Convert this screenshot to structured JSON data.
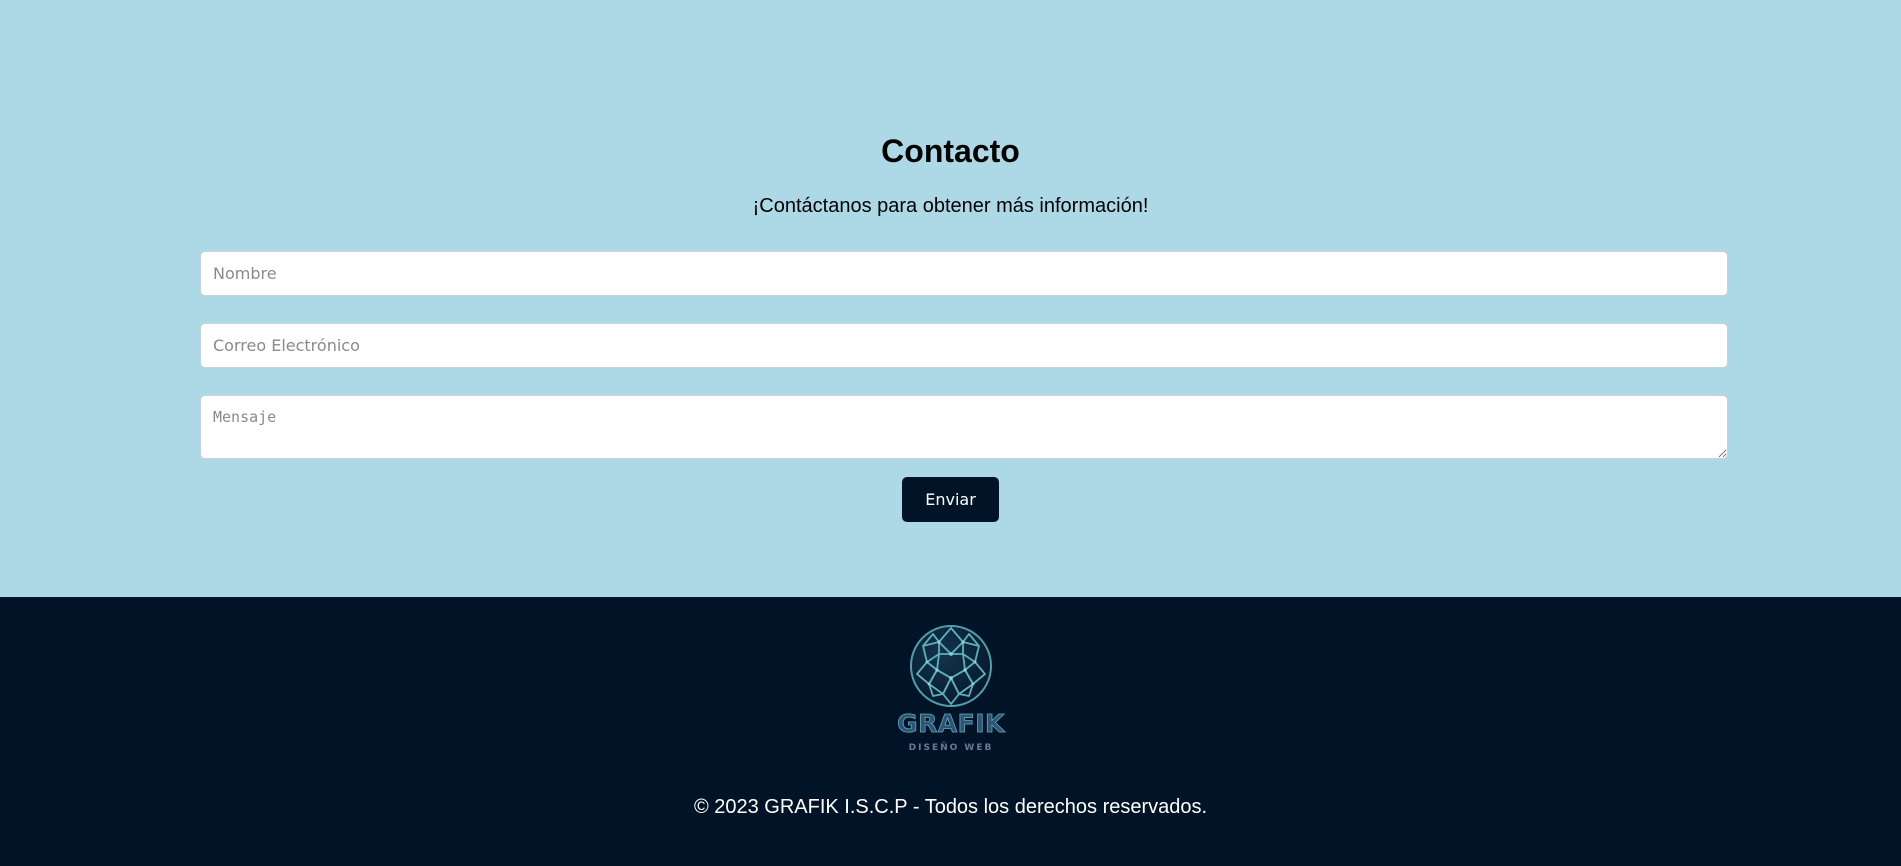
{
  "contact": {
    "title": "Contacto",
    "subtitle": "¡Contáctanos para obtener más información!",
    "name_placeholder": "Nombre",
    "email_placeholder": "Correo Electrónico",
    "message_placeholder": "Mensaje",
    "name_value": "",
    "email_value": "",
    "message_value": "",
    "submit_label": "Enviar"
  },
  "footer": {
    "logo_icon": "globe-mesh-icon",
    "logo_word": "GRAFIK",
    "logo_tagline": "DISEÑO WEB",
    "copyright": "© 2023 GRAFIK I.S.C.P - Todos los derechos reservados."
  },
  "colors": {
    "background": "#add8e6",
    "footer_background": "#011427",
    "button_background": "#011427",
    "logo_accent": "#5fa9b4"
  }
}
